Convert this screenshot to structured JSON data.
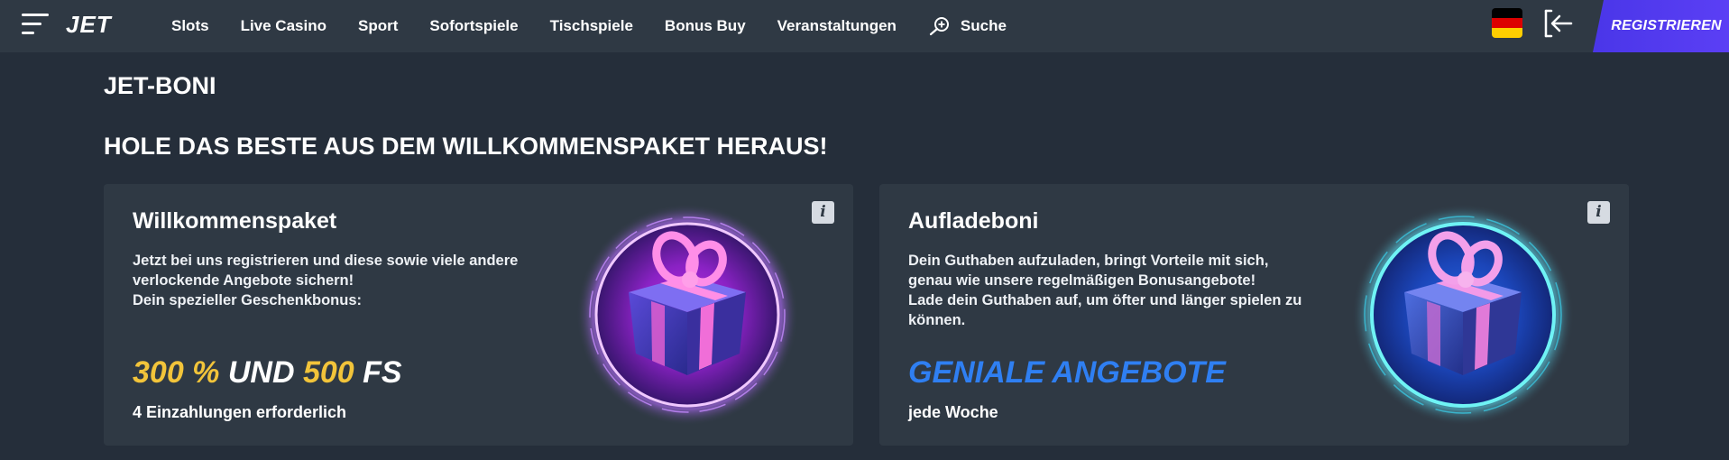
{
  "header": {
    "logo": "JET",
    "nav": [
      "Slots",
      "Live Casino",
      "Sport",
      "Sofortspiele",
      "Tischspiele",
      "Bonus Buy",
      "Veranstaltungen"
    ],
    "search_label": "Suche",
    "register_label": "REGISTRIEREN",
    "flag_colors": [
      "#000000",
      "#dd0000",
      "#ffce00"
    ]
  },
  "page": {
    "title": "JET-BONI",
    "section_title": "HOLE DAS BESTE AUS DEM WILLKOMMENSPAKET HERAUS!"
  },
  "cards": [
    {
      "title": "Willkommenspaket",
      "text": [
        "Jetzt bei uns registrieren und diese sowie viele andere",
        "verlockende Angebote sichern!",
        "Dein spezieller Geschenkbonus:"
      ],
      "offer_parts": [
        "300 %",
        " UND ",
        "500",
        " FS"
      ],
      "offer_sub": "4 Einzahlungen erforderlich",
      "info_label": "i",
      "image_icon": "gift-purple-icon"
    },
    {
      "title": "Aufladeboni",
      "text": [
        "Dein Guthaben aufzuladen, bringt Vorteile mit sich,",
        "genau wie unsere regelmäßigen Bonusangebote!",
        "Lade dein Guthaben auf, um öfter und länger spielen zu",
        "können."
      ],
      "offer": "GENIALE ANGEBOTE",
      "offer_sub": "jede Woche",
      "info_label": "i",
      "image_icon": "gift-cyan-icon"
    }
  ],
  "colors": {
    "background": "#252e3a",
    "header": "#2f3944",
    "card": "#2f3944",
    "gold": "#f2c43a",
    "blue": "#2f7ff2",
    "register": "#4a36e8"
  }
}
